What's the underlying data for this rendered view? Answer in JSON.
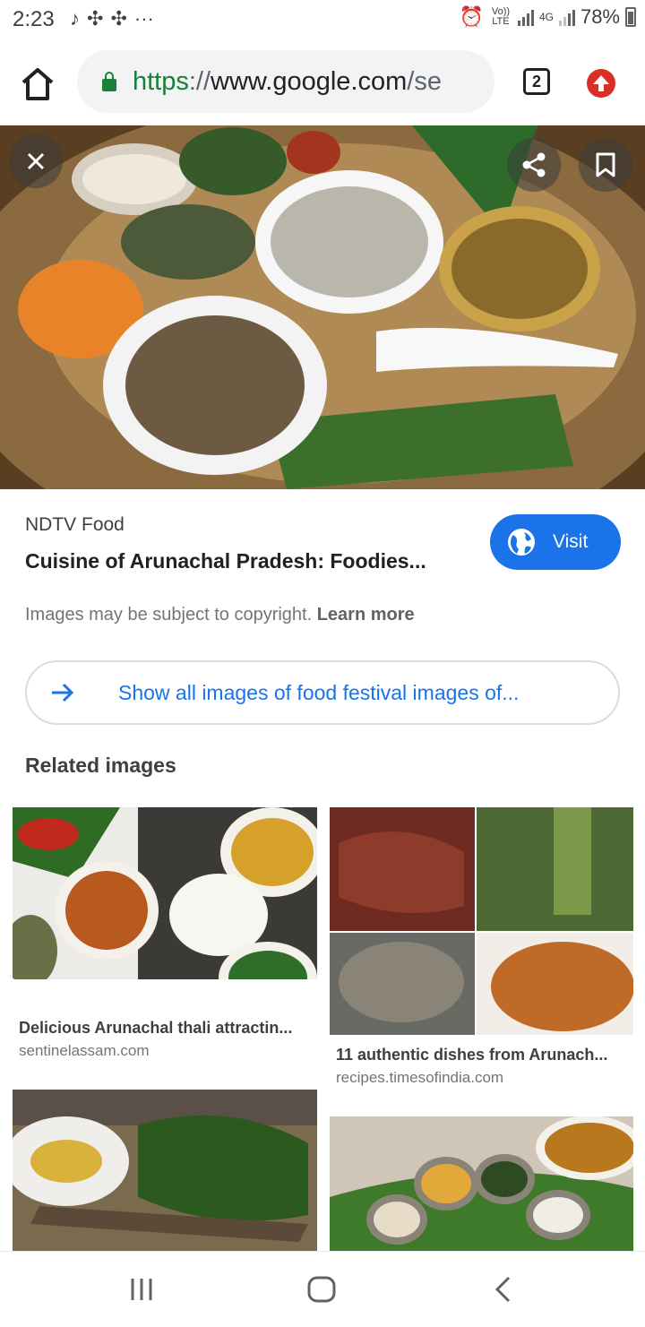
{
  "status_bar": {
    "time": "2:23",
    "notification_icons": [
      "tiktok-icon",
      "app-icon",
      "app-icon",
      "more-dots-icon"
    ],
    "network_volte": "Vo)) LTE",
    "network_4g": "4G",
    "battery": "78%"
  },
  "browser": {
    "url_scheme": "https",
    "url_sep": "://",
    "url_host": "www.google.com",
    "url_rest": "/se",
    "tab_count": "2"
  },
  "image_result": {
    "source": "NDTV Food",
    "title": "Cuisine of Arunachal Pradesh: Foodies...",
    "visit_label": "Visit",
    "copyright_text": "Images may be subject to copyright.",
    "learn_more": "Learn more",
    "show_all_label": "Show all images of food festival images of..."
  },
  "related": {
    "heading": "Related images",
    "items": [
      {
        "caption": "Delicious Arunachal thali attractin...",
        "domain": "sentinelassam.com"
      },
      {
        "caption": "11 authentic dishes from Arunach...",
        "domain": "recipes.timesofindia.com"
      }
    ]
  },
  "colors": {
    "accent": "#1a73e8",
    "secure_green": "#188038",
    "update_red": "#d93025"
  }
}
